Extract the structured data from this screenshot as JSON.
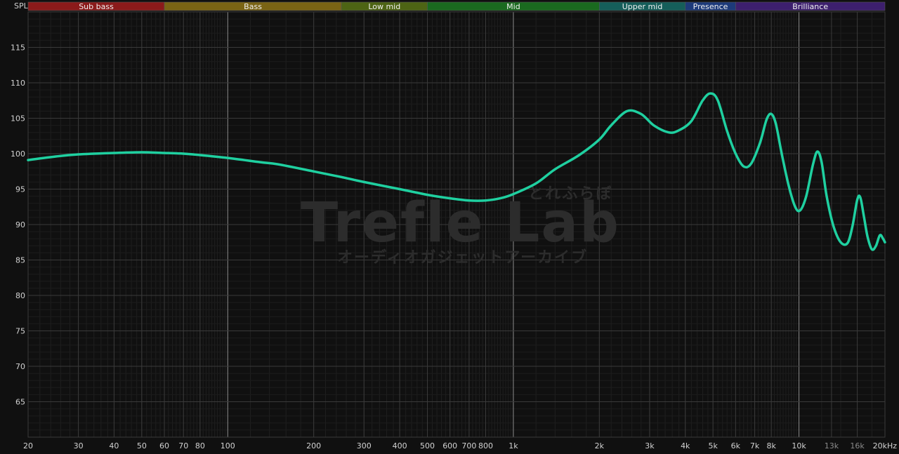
{
  "chart_data": {
    "type": "line",
    "ylabel": "SPL",
    "xscale": "log",
    "xlim": [
      20,
      20000
    ],
    "ylim": [
      60,
      120
    ],
    "grid": true,
    "x_ticks": [
      {
        "v": 20,
        "label": "20"
      },
      {
        "v": 30,
        "label": "30"
      },
      {
        "v": 40,
        "label": "40"
      },
      {
        "v": 50,
        "label": "50"
      },
      {
        "v": 60,
        "label": "60"
      },
      {
        "v": 70,
        "label": "70"
      },
      {
        "v": 80,
        "label": "80"
      },
      {
        "v": 100,
        "label": "100"
      },
      {
        "v": 200,
        "label": "200"
      },
      {
        "v": 300,
        "label": "300"
      },
      {
        "v": 400,
        "label": "400"
      },
      {
        "v": 500,
        "label": "500"
      },
      {
        "v": 600,
        "label": "600"
      },
      {
        "v": 700,
        "label": "700"
      },
      {
        "v": 800,
        "label": "800"
      },
      {
        "v": 1000,
        "label": "1k"
      },
      {
        "v": 2000,
        "label": "2k"
      },
      {
        "v": 3000,
        "label": "3k"
      },
      {
        "v": 4000,
        "label": "4k"
      },
      {
        "v": 5000,
        "label": "5k"
      },
      {
        "v": 6000,
        "label": "6k"
      },
      {
        "v": 7000,
        "label": "7k"
      },
      {
        "v": 8000,
        "label": "8k"
      },
      {
        "v": 10000,
        "label": "10k"
      },
      {
        "v": 13000,
        "label": "13k",
        "dim": true
      },
      {
        "v": 16000,
        "label": "16k",
        "dim": true
      },
      {
        "v": 20000,
        "label": "20kHz"
      }
    ],
    "y_ticks": [
      65,
      70,
      75,
      80,
      85,
      90,
      95,
      100,
      105,
      110,
      115
    ],
    "bands": [
      {
        "name": "Sub bass",
        "from": 20,
        "to": 60,
        "color": "#8b1a1a"
      },
      {
        "name": "Bass",
        "from": 60,
        "to": 250,
        "color": "#7a6414"
      },
      {
        "name": "Low mid",
        "from": 250,
        "to": 500,
        "color": "#4d6414"
      },
      {
        "name": "Mid",
        "from": 500,
        "to": 2000,
        "color": "#1a6a1f"
      },
      {
        "name": "Upper mid",
        "from": 2000,
        "to": 4000,
        "color": "#155e5a"
      },
      {
        "name": "Presence",
        "from": 4000,
        "to": 6000,
        "color": "#1d3a7a"
      },
      {
        "name": "Brilliance",
        "from": 6000,
        "to": 20000,
        "color": "#3d1f6e"
      }
    ],
    "series": [
      {
        "color": "#1fd0a0",
        "points": [
          [
            20,
            99.1
          ],
          [
            25,
            99.6
          ],
          [
            30,
            99.9
          ],
          [
            40,
            100.1
          ],
          [
            50,
            100.2
          ],
          [
            60,
            100.1
          ],
          [
            70,
            100.0
          ],
          [
            80,
            99.8
          ],
          [
            100,
            99.4
          ],
          [
            130,
            98.8
          ],
          [
            150,
            98.5
          ],
          [
            200,
            97.5
          ],
          [
            250,
            96.7
          ],
          [
            300,
            96.0
          ],
          [
            400,
            95.0
          ],
          [
            500,
            94.2
          ],
          [
            600,
            93.7
          ],
          [
            700,
            93.4
          ],
          [
            800,
            93.4
          ],
          [
            900,
            93.7
          ],
          [
            1000,
            94.3
          ],
          [
            1200,
            95.8
          ],
          [
            1400,
            97.8
          ],
          [
            1700,
            99.8
          ],
          [
            2000,
            102.0
          ],
          [
            2200,
            104.0
          ],
          [
            2500,
            106.0
          ],
          [
            2800,
            105.6
          ],
          [
            3100,
            104.0
          ],
          [
            3500,
            103.0
          ],
          [
            3800,
            103.3
          ],
          [
            4200,
            104.6
          ],
          [
            4600,
            107.5
          ],
          [
            4900,
            108.5
          ],
          [
            5200,
            107.5
          ],
          [
            5600,
            103.2
          ],
          [
            6000,
            100.0
          ],
          [
            6400,
            98.2
          ],
          [
            6800,
            98.6
          ],
          [
            7300,
            101.5
          ],
          [
            7700,
            104.8
          ],
          [
            8000,
            105.6
          ],
          [
            8300,
            104.2
          ],
          [
            8700,
            100.0
          ],
          [
            9200,
            95.5
          ],
          [
            9700,
            92.5
          ],
          [
            10100,
            92.0
          ],
          [
            10600,
            94.0
          ],
          [
            11200,
            98.5
          ],
          [
            11600,
            100.3
          ],
          [
            12000,
            98.8
          ],
          [
            12500,
            94.0
          ],
          [
            13200,
            89.8
          ],
          [
            14000,
            87.5
          ],
          [
            14800,
            87.4
          ],
          [
            15400,
            89.8
          ],
          [
            16000,
            93.5
          ],
          [
            16400,
            93.8
          ],
          [
            16900,
            91.0
          ],
          [
            17400,
            88.2
          ],
          [
            18000,
            86.5
          ],
          [
            18600,
            87.0
          ],
          [
            19200,
            88.5
          ],
          [
            19700,
            88.0
          ],
          [
            20000,
            87.5
          ]
        ]
      }
    ]
  },
  "watermark": {
    "title": "Trefle Lab",
    "kana_top": "とれふらぼ",
    "subtitle": "オーディオガジェットアーカイブ"
  }
}
